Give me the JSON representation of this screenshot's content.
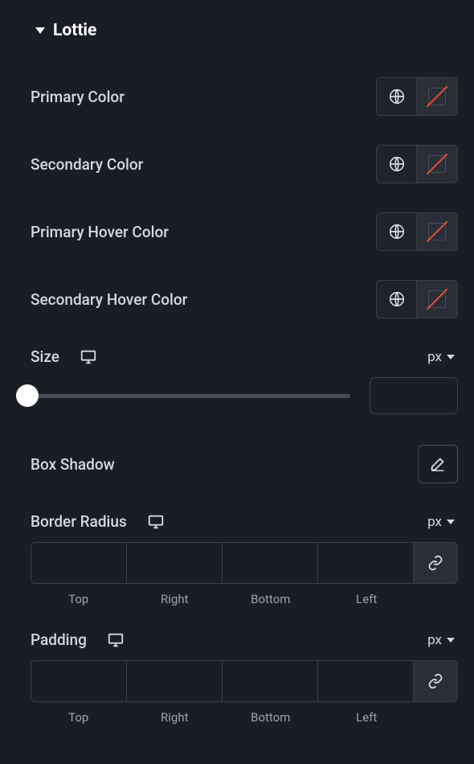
{
  "section": {
    "title": "Lottie"
  },
  "colors": {
    "primary": {
      "label": "Primary Color"
    },
    "secondary": {
      "label": "Secondary Color"
    },
    "primaryHover": {
      "label": "Primary Hover Color"
    },
    "secondaryHover": {
      "label": "Secondary Hover Color"
    }
  },
  "size": {
    "label": "Size",
    "unit": "px",
    "value": ""
  },
  "boxShadow": {
    "label": "Box Shadow"
  },
  "borderRadius": {
    "label": "Border Radius",
    "unit": "px",
    "sides": {
      "top": "Top",
      "right": "Right",
      "bottom": "Bottom",
      "left": "Left"
    },
    "values": {
      "top": "",
      "right": "",
      "bottom": "",
      "left": ""
    }
  },
  "padding": {
    "label": "Padding",
    "unit": "px",
    "sides": {
      "top": "Top",
      "right": "Right",
      "bottom": "Bottom",
      "left": "Left"
    },
    "values": {
      "top": "",
      "right": "",
      "bottom": "",
      "left": ""
    }
  }
}
